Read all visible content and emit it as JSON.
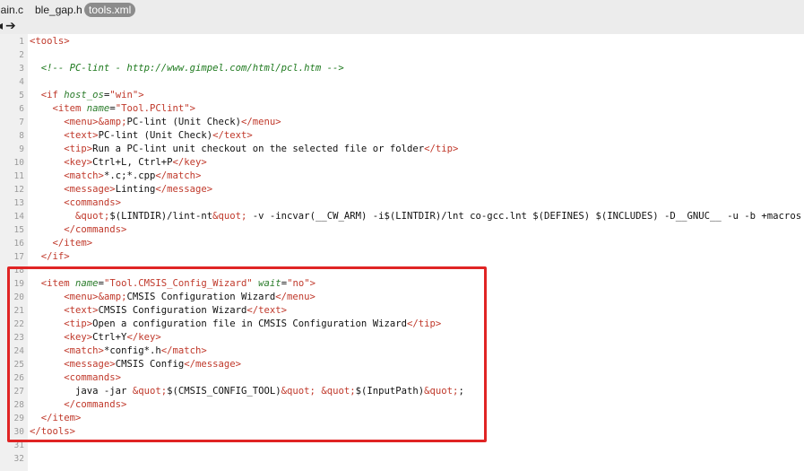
{
  "tabs": [
    {
      "label": "main.c",
      "visible_text": "nain.c",
      "active": false
    },
    {
      "label": "ble_gap.h",
      "active": false
    },
    {
      "label": "tools.xml",
      "active": true
    }
  ],
  "toolbar": {
    "back_icon": "back-arrow-icon",
    "forward_icon": "forward-arrow-icon"
  },
  "colors": {
    "tag": "#c0392b",
    "attribute": "#2b7c2b",
    "comment": "#1f7a1f",
    "highlight_border": "#e02424"
  },
  "editor": {
    "lines": [
      {
        "n": "1",
        "segments": [
          {
            "c": "t-tag",
            "t": "<tools>"
          }
        ]
      },
      {
        "n": "2",
        "segments": []
      },
      {
        "n": "3",
        "segments": [
          {
            "c": "",
            "t": "  "
          },
          {
            "c": "t-com",
            "t": "<!-- PC-lint - http://www.gimpel.com/html/pcl.htm -->"
          }
        ]
      },
      {
        "n": "4",
        "segments": []
      },
      {
        "n": "5",
        "segments": [
          {
            "c": "",
            "t": "  "
          },
          {
            "c": "t-tag",
            "t": "<if "
          },
          {
            "c": "t-attr",
            "t": "host_os"
          },
          {
            "c": "",
            "t": "="
          },
          {
            "c": "t-val",
            "t": "\"win\""
          },
          {
            "c": "t-tag",
            "t": ">"
          }
        ]
      },
      {
        "n": "6",
        "segments": [
          {
            "c": "",
            "t": "    "
          },
          {
            "c": "t-tag",
            "t": "<item "
          },
          {
            "c": "t-attr",
            "t": "name"
          },
          {
            "c": "",
            "t": "="
          },
          {
            "c": "t-val",
            "t": "\"Tool.PClint\""
          },
          {
            "c": "t-tag",
            "t": ">"
          }
        ]
      },
      {
        "n": "7",
        "segments": [
          {
            "c": "",
            "t": "      "
          },
          {
            "c": "t-tag",
            "t": "<menu>"
          },
          {
            "c": "t-tag",
            "t": "&amp;"
          },
          {
            "c": "",
            "t": "PC-lint (Unit Check)"
          },
          {
            "c": "t-tag",
            "t": "</menu>"
          }
        ]
      },
      {
        "n": "8",
        "segments": [
          {
            "c": "",
            "t": "      "
          },
          {
            "c": "t-tag",
            "t": "<text>"
          },
          {
            "c": "",
            "t": "PC-lint (Unit Check)"
          },
          {
            "c": "t-tag",
            "t": "</text>"
          }
        ]
      },
      {
        "n": "9",
        "segments": [
          {
            "c": "",
            "t": "      "
          },
          {
            "c": "t-tag",
            "t": "<tip>"
          },
          {
            "c": "",
            "t": "Run a PC-lint unit checkout on the selected file or folder"
          },
          {
            "c": "t-tag",
            "t": "</tip>"
          }
        ]
      },
      {
        "n": "10",
        "segments": [
          {
            "c": "",
            "t": "      "
          },
          {
            "c": "t-tag",
            "t": "<key>"
          },
          {
            "c": "",
            "t": "Ctrl+L, Ctrl+P"
          },
          {
            "c": "t-tag",
            "t": "</key>"
          }
        ]
      },
      {
        "n": "11",
        "segments": [
          {
            "c": "",
            "t": "      "
          },
          {
            "c": "t-tag",
            "t": "<match>"
          },
          {
            "c": "",
            "t": "*.c;*.cpp"
          },
          {
            "c": "t-tag",
            "t": "</match>"
          }
        ]
      },
      {
        "n": "12",
        "segments": [
          {
            "c": "",
            "t": "      "
          },
          {
            "c": "t-tag",
            "t": "<message>"
          },
          {
            "c": "",
            "t": "Linting"
          },
          {
            "c": "t-tag",
            "t": "</message>"
          }
        ]
      },
      {
        "n": "13",
        "segments": [
          {
            "c": "",
            "t": "      "
          },
          {
            "c": "t-tag",
            "t": "<commands>"
          }
        ]
      },
      {
        "n": "14",
        "segments": [
          {
            "c": "",
            "t": "        "
          },
          {
            "c": "t-tag",
            "t": "&quot;"
          },
          {
            "c": "",
            "t": "$(LINTDIR)/lint-nt"
          },
          {
            "c": "t-tag",
            "t": "&quot;"
          },
          {
            "c": "",
            "t": " -v -incvar(__CW_ARM) -i$(LINTDIR)/lnt co-gcc.lnt $(DEFINES) $(INCLUDES) -D__GNUC__ -u -b +macros"
          }
        ]
      },
      {
        "n": "15",
        "segments": [
          {
            "c": "",
            "t": "      "
          },
          {
            "c": "t-tag",
            "t": "</commands>"
          }
        ]
      },
      {
        "n": "16",
        "segments": [
          {
            "c": "",
            "t": "    "
          },
          {
            "c": "t-tag",
            "t": "</item>"
          }
        ]
      },
      {
        "n": "17",
        "segments": [
          {
            "c": "",
            "t": "  "
          },
          {
            "c": "t-tag",
            "t": "</if>"
          }
        ]
      },
      {
        "n": "18",
        "segments": []
      },
      {
        "n": "19",
        "segments": [
          {
            "c": "",
            "t": "  "
          },
          {
            "c": "t-tag",
            "t": "<item "
          },
          {
            "c": "t-attr",
            "t": "name"
          },
          {
            "c": "",
            "t": "="
          },
          {
            "c": "t-val",
            "t": "\"Tool.CMSIS_Config_Wizard\""
          },
          {
            "c": "",
            "t": " "
          },
          {
            "c": "t-attr",
            "t": "wait"
          },
          {
            "c": "",
            "t": "="
          },
          {
            "c": "t-val",
            "t": "\"no\""
          },
          {
            "c": "t-tag",
            "t": ">"
          }
        ]
      },
      {
        "n": "20",
        "segments": [
          {
            "c": "",
            "t": "      "
          },
          {
            "c": "t-tag",
            "t": "<menu>"
          },
          {
            "c": "t-tag",
            "t": "&amp;"
          },
          {
            "c": "",
            "t": "CMSIS Configuration Wizard"
          },
          {
            "c": "t-tag",
            "t": "</menu>"
          }
        ]
      },
      {
        "n": "21",
        "segments": [
          {
            "c": "",
            "t": "      "
          },
          {
            "c": "t-tag",
            "t": "<text>"
          },
          {
            "c": "",
            "t": "CMSIS Configuration Wizard"
          },
          {
            "c": "t-tag",
            "t": "</text>"
          }
        ]
      },
      {
        "n": "22",
        "segments": [
          {
            "c": "",
            "t": "      "
          },
          {
            "c": "t-tag",
            "t": "<tip>"
          },
          {
            "c": "",
            "t": "Open a configuration file in CMSIS Configuration Wizard"
          },
          {
            "c": "t-tag",
            "t": "</tip>"
          }
        ]
      },
      {
        "n": "23",
        "segments": [
          {
            "c": "",
            "t": "      "
          },
          {
            "c": "t-tag",
            "t": "<key>"
          },
          {
            "c": "",
            "t": "Ctrl+Y"
          },
          {
            "c": "t-tag",
            "t": "</key>"
          }
        ]
      },
      {
        "n": "24",
        "segments": [
          {
            "c": "",
            "t": "      "
          },
          {
            "c": "t-tag",
            "t": "<match>"
          },
          {
            "c": "",
            "t": "*config*.h"
          },
          {
            "c": "t-tag",
            "t": "</match>"
          }
        ]
      },
      {
        "n": "25",
        "segments": [
          {
            "c": "",
            "t": "      "
          },
          {
            "c": "t-tag",
            "t": "<message>"
          },
          {
            "c": "",
            "t": "CMSIS Config"
          },
          {
            "c": "t-tag",
            "t": "</message>"
          }
        ]
      },
      {
        "n": "26",
        "segments": [
          {
            "c": "",
            "t": "      "
          },
          {
            "c": "t-tag",
            "t": "<commands>"
          }
        ]
      },
      {
        "n": "27",
        "segments": [
          {
            "c": "",
            "t": "        java -jar "
          },
          {
            "c": "t-tag",
            "t": "&quot;"
          },
          {
            "c": "",
            "t": "$(CMSIS_CONFIG_TOOL)"
          },
          {
            "c": "t-tag",
            "t": "&quot;"
          },
          {
            "c": "",
            "t": " "
          },
          {
            "c": "t-tag",
            "t": "&quot;"
          },
          {
            "c": "",
            "t": "$(InputPath)"
          },
          {
            "c": "t-tag",
            "t": "&quot;"
          },
          {
            "c": "",
            "t": ";"
          }
        ]
      },
      {
        "n": "28",
        "segments": [
          {
            "c": "",
            "t": "      "
          },
          {
            "c": "t-tag",
            "t": "</commands>"
          }
        ]
      },
      {
        "n": "29",
        "segments": [
          {
            "c": "",
            "t": "  "
          },
          {
            "c": "t-tag",
            "t": "</item>"
          }
        ]
      },
      {
        "n": "30",
        "segments": [
          {
            "c": "t-tag",
            "t": "</tools>"
          }
        ]
      },
      {
        "n": "31",
        "segments": []
      },
      {
        "n": "32",
        "segments": []
      }
    ]
  }
}
